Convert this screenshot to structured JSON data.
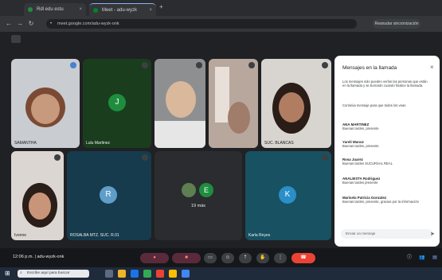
{
  "browser": {
    "tabs": [
      {
        "label": "Rdl edu estu",
        "active": false
      },
      {
        "label": "Meet - adu-wyzk",
        "active": true
      }
    ],
    "new_tab": "+",
    "url": "meet.google.com/adu-wyzk-onk",
    "right_button": "Reanudar sincronización"
  },
  "meet": {
    "time": "12:06 p.m.",
    "meeting_code": "adu-wyzk-onk",
    "participants": [
      {
        "name": "SAMANTHA",
        "type": "video"
      },
      {
        "name": "Lulu Martinez",
        "type": "avatar",
        "initial": "J",
        "color": "#1e8e3e"
      },
      {
        "name": "",
        "type": "video"
      },
      {
        "name": "",
        "type": "video"
      },
      {
        "name": "SUC. BLANCAS",
        "type": "video"
      },
      {
        "name": "Ivonne",
        "type": "video"
      },
      {
        "name": "ROSALBA MTZ. SUC. R.01",
        "type": "avatar",
        "initial": "R",
        "color": "#5f9ec9"
      },
      {
        "name": "19 más",
        "type": "more",
        "initial": "E",
        "color": "#1e8e3e"
      },
      {
        "name": "Karla Reyes",
        "type": "avatar",
        "initial": "K",
        "color": "#2a8fc9"
      }
    ]
  },
  "chat": {
    "title": "Mensajes en la llamada",
    "close_icon": "×",
    "notice": "Los mensajes solo pueden verlos las personas que están en la llamada y se borrarán cuando finalice la llamada.",
    "messages": [
      {
        "sender": "",
        "text": "Continúa mensaje para que todos los vean"
      },
      {
        "sender": "ANA MARTINEZ",
        "text": "Buenas tardes, presente"
      },
      {
        "sender": "Yareli Munoz",
        "text": "Buenas tardes, presente"
      },
      {
        "sender": "Rosa Juarez",
        "text": "Buenas tardes SUCURSAL REAL"
      },
      {
        "sender": "ANALIESTA Rodriguez",
        "text": "Buenas tardes presente"
      },
      {
        "sender": "Marisela Patricia Gonzalez",
        "text": "Buenas tardes, presente, gracias por la información"
      }
    ],
    "input_placeholder": "Enviar un mensaje"
  },
  "taskbar": {
    "search_placeholder": "Escribe aquí para buscar"
  }
}
